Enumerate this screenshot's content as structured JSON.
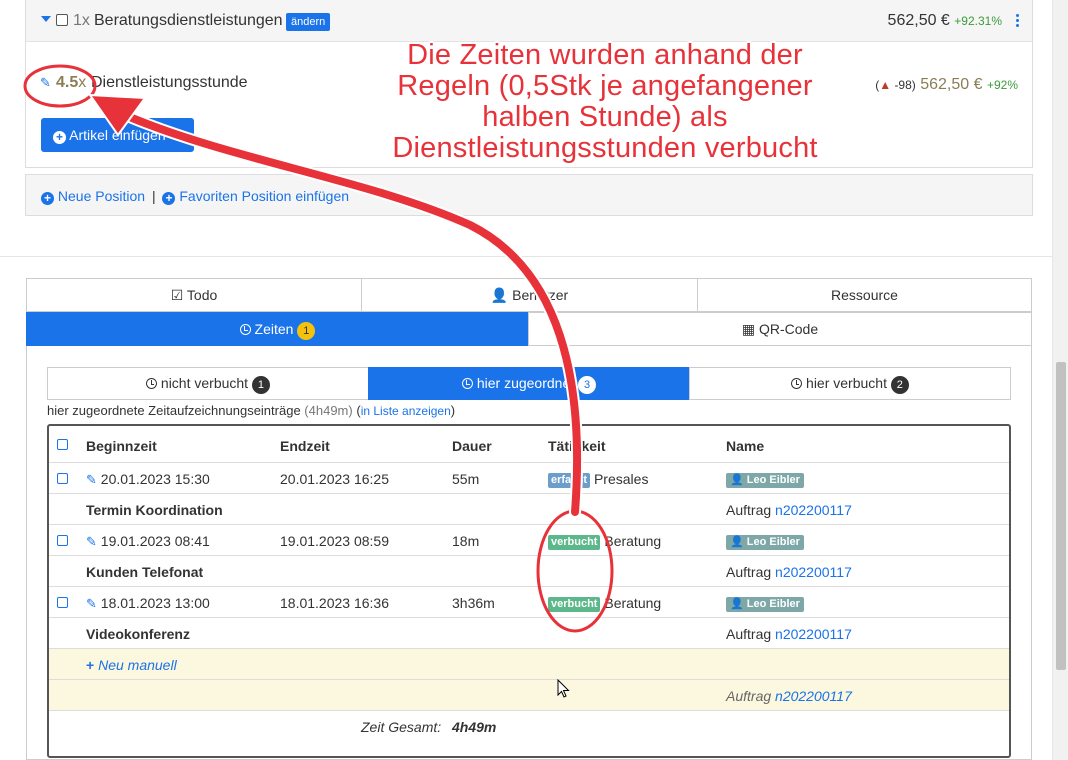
{
  "position": {
    "quantity": "1x",
    "title": "Beratungsdienstleistungen",
    "change_label": "ändern",
    "price": "562,50 €",
    "percent": "+92.31%"
  },
  "item": {
    "quantity": "4.5",
    "quantity_suffix": "x",
    "name": "Dienstleistungsstunde",
    "warning_value": "-98",
    "price": "562,50 €",
    "percent": "+92%"
  },
  "add_article_label": "Artikel einfügen",
  "new_position": {
    "new_label": "Neue Position",
    "separator": "|",
    "favorites_label": "Favoriten Position einfügen"
  },
  "tabs_row1": [
    {
      "label": "Todo"
    },
    {
      "label": "Benutzer"
    },
    {
      "label": "Ressource"
    }
  ],
  "tabs_row2": [
    {
      "label": "Zeiten",
      "badge": "1"
    },
    {
      "label": "QR-Code"
    }
  ],
  "subtabs": [
    {
      "label": "nicht verbucht",
      "badge": "1"
    },
    {
      "label": "hier zugeordnet",
      "badge": "3"
    },
    {
      "label": "hier verbucht",
      "badge": "2"
    }
  ],
  "summary": {
    "text": "hier zugeordnete Zeitaufzeichnungseinträge",
    "duration": "(4h49m)",
    "paren_open": "(",
    "link": "in Liste anzeigen",
    "paren_close": ")"
  },
  "table": {
    "headers": {
      "begin": "Beginnzeit",
      "end": "Endzeit",
      "duration": "Dauer",
      "activity": "Tätigkeit",
      "name": "Name"
    },
    "entries": [
      {
        "begin": "20.01.2023 15:30",
        "end": "20.01.2023 16:25",
        "duration": "55m",
        "status": "erfasst",
        "activity": "Presales",
        "user": "Leo Eibler",
        "note": "Termin Koordination",
        "order_label": "Auftrag",
        "order_no": "n202200117"
      },
      {
        "begin": "19.01.2023 08:41",
        "end": "19.01.2023 08:59",
        "duration": "18m",
        "status": "verbucht",
        "activity": "Beratung",
        "user": "Leo Eibler",
        "note": "Kunden Telefonat",
        "order_label": "Auftrag",
        "order_no": "n202200117"
      },
      {
        "begin": "18.01.2023 13:00",
        "end": "18.01.2023 16:36",
        "duration": "3h36m",
        "status": "verbucht",
        "activity": "Beratung",
        "user": "Leo Eibler",
        "note": "Videokonferenz",
        "order_label": "Auftrag",
        "order_no": "n202200117"
      }
    ],
    "new_manual_label": "Neu manuell",
    "manual_order_label": "Auftrag",
    "manual_order_no": "n202200117",
    "total_label": "Zeit Gesamt:",
    "total_value": "4h49m"
  },
  "annotation": {
    "lines": [
      "Die Zeiten wurden anhand der",
      "Regeln (0,5Stk je angefangener",
      "halben Stunde) als",
      "Dienstleistungsstunden verbucht"
    ],
    "color": "#e8323a"
  },
  "colors": {
    "primary": "#1a73e8",
    "annotation": "#e8323a",
    "status_erfasst": "#6b9ecb",
    "status_verbucht": "#5cb88a"
  }
}
